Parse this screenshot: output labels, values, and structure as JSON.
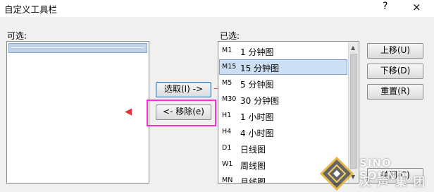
{
  "window": {
    "title": "自定义工具栏",
    "help_symbol": "?",
    "close_symbol": "×"
  },
  "available": {
    "label": "可选:"
  },
  "selected": {
    "label": "已选:",
    "items": [
      {
        "code": "M1",
        "name": "1 分钟图"
      },
      {
        "code": "M15",
        "name": "15 分钟图"
      },
      {
        "code": "M5",
        "name": "5 分钟图"
      },
      {
        "code": "M30",
        "name": "30 分钟图"
      },
      {
        "code": "H1",
        "name": "1 小时图"
      },
      {
        "code": "H4",
        "name": "4 小时图"
      },
      {
        "code": "D1",
        "name": "日线图"
      },
      {
        "code": "W1",
        "name": "周线图"
      },
      {
        "code": "MN",
        "name": "月线图"
      }
    ],
    "selected_index": 1
  },
  "buttons": {
    "add": "选取(I) ->",
    "remove": "<- 移除(e)",
    "move_up": "上移(U)",
    "move_down": "下移(D)",
    "reset": "重置(R)",
    "close": "关闭(C)"
  },
  "watermark": {
    "line1": "SINO SOUND",
    "line2": "汉 声 集 团"
  },
  "colors": {
    "selection": "#cde0f3",
    "highlight_box": "#ff2bd6",
    "red_arrow": "#e8313b"
  }
}
